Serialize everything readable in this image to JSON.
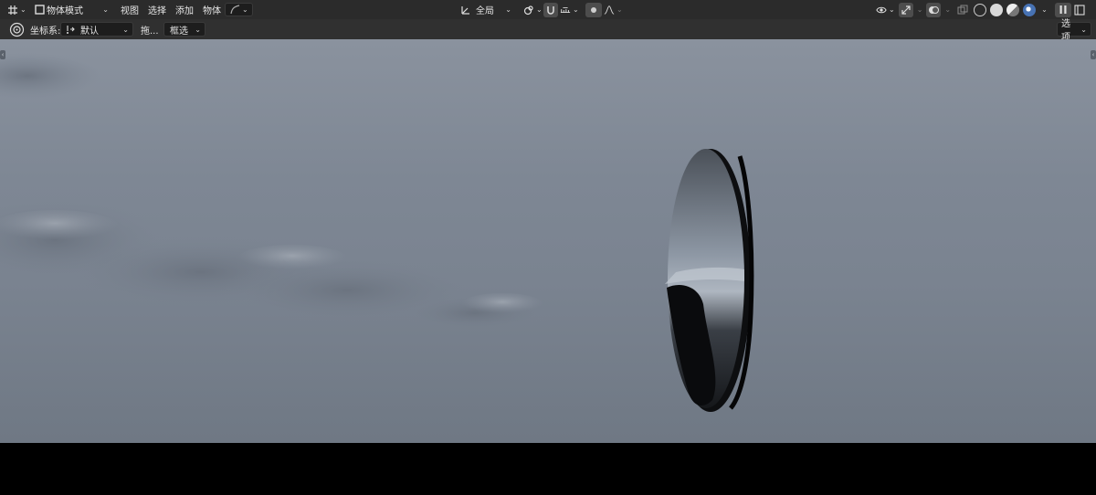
{
  "header": {
    "editor_type_icon": "transform-icon",
    "mode": {
      "icon": "object-mode-icon",
      "label": "物体模式"
    },
    "menus": [
      "视图",
      "选择",
      "添加",
      "物体"
    ],
    "orientation": {
      "icon": "orientation-icon",
      "label": "全局"
    },
    "options_label": "选项"
  },
  "tool_header": {
    "coord_label": "坐标系:",
    "coord_value": "默认",
    "drag_label": "拖...",
    "select_value": "框选"
  },
  "colors": {
    "header_bg": "#2b2b2b",
    "tool_header_bg": "#303030",
    "accent": "#4772b3",
    "sky_top": "#8a929e",
    "sky_bottom": "#6f7884"
  }
}
